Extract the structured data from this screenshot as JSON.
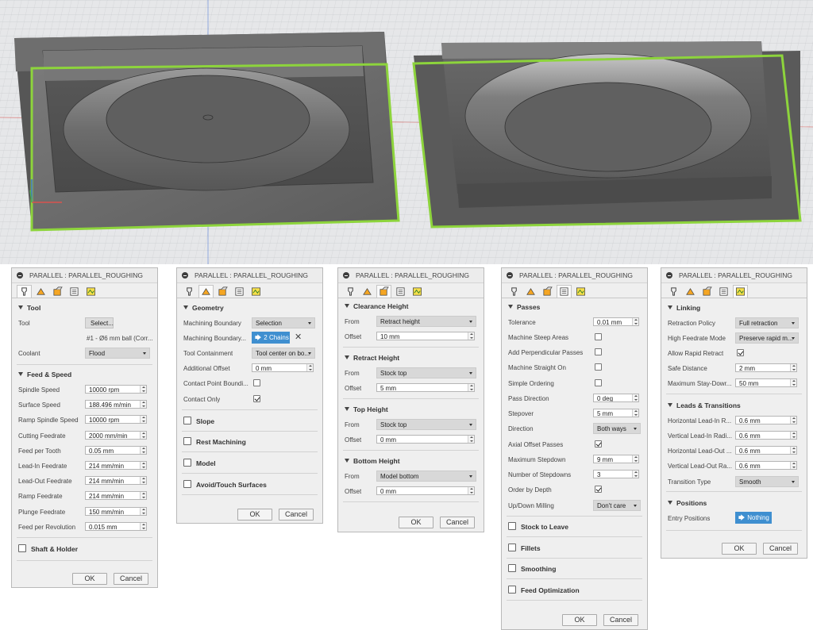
{
  "colors": {
    "selection_outline": "#8dd43c",
    "chip": "#3f8fd0",
    "axis_x": "#d9534f",
    "axis_y": "#3b6bd6",
    "axis_z": "#4caf50"
  },
  "panels": [
    {
      "title": "PARALLEL : PARALLEL_ROUGHING",
      "tab_icons": [
        "tool-tab-icon",
        "geometry-tab-icon",
        "heights-tab-icon",
        "passes-tab-icon",
        "linking-tab-icon"
      ],
      "sections": [
        {
          "name": "Tool",
          "expanded": true
        },
        {
          "name": "Feed & Speed",
          "expanded": true
        },
        {
          "name": "Shaft & Holder",
          "expanded": false
        }
      ],
      "tool": {
        "label": "Tool",
        "button": "Select...",
        "description": "#1 - Ø6 mm ball (Corr..."
      },
      "coolant": {
        "label": "Coolant",
        "value": "Flood"
      },
      "feed_speed": [
        {
          "label": "Spindle Speed",
          "value": "10000 rpm"
        },
        {
          "label": "Surface Speed",
          "value": "188.496 m/min"
        },
        {
          "label": "Ramp Spindle Speed",
          "value": "10000 rpm"
        },
        {
          "label": "Cutting Feedrate",
          "value": "2000 mm/min"
        },
        {
          "label": "Feed per Tooth",
          "value": "0.05 mm"
        },
        {
          "label": "Lead-In Feedrate",
          "value": "214 mm/min"
        },
        {
          "label": "Lead-Out Feedrate",
          "value": "214 mm/min"
        },
        {
          "label": "Ramp Feedrate",
          "value": "214 mm/min"
        },
        {
          "label": "Plunge Feedrate",
          "value": "150 mm/min"
        },
        {
          "label": "Feed per Revolution",
          "value": "0.015 mm"
        }
      ],
      "ok": "OK",
      "cancel": "Cancel"
    },
    {
      "title": "PARALLEL : PARALLEL_ROUGHING",
      "sections": [
        {
          "name": "Geometry",
          "expanded": true
        },
        {
          "name": "Slope",
          "expanded": false
        },
        {
          "name": "Rest Machining",
          "expanded": false
        },
        {
          "name": "Model",
          "expanded": false
        },
        {
          "name": "Avoid/Touch Surfaces",
          "expanded": false
        }
      ],
      "machining_boundary": {
        "label": "Machining Boundary",
        "value": "Selection"
      },
      "machining_boundary_sel": {
        "label": "Machining Boundary...",
        "value": "2 Chains"
      },
      "tool_containment": {
        "label": "Tool Containment",
        "value": "Tool center on bo..."
      },
      "additional_offset": {
        "label": "Additional Offset",
        "value": "0 mm"
      },
      "contact_point": {
        "label": "Contact Point Boundi...",
        "checked": false
      },
      "contact_only": {
        "label": "Contact Only",
        "checked": true
      },
      "ok": "OK",
      "cancel": "Cancel"
    },
    {
      "title": "PARALLEL : PARALLEL_ROUGHING",
      "sections": [
        {
          "name": "Clearance Height",
          "from": "Retract height",
          "offset": "10 mm"
        },
        {
          "name": "Retract Height",
          "from": "Stock top",
          "offset": "5 mm"
        },
        {
          "name": "Top Height",
          "from": "Stock top",
          "offset": "0 mm"
        },
        {
          "name": "Bottom Height",
          "from": "Model bottom",
          "offset": "0 mm"
        }
      ],
      "from_label": "From",
      "offset_label": "Offset",
      "ok": "OK",
      "cancel": "Cancel"
    },
    {
      "title": "PARALLEL : PARALLEL_ROUGHING",
      "sections": [
        {
          "name": "Passes",
          "expanded": true
        },
        {
          "name": "Stock to Leave",
          "expanded": false
        },
        {
          "name": "Fillets",
          "expanded": false
        },
        {
          "name": "Smoothing",
          "expanded": false
        },
        {
          "name": "Feed Optimization",
          "expanded": false
        }
      ],
      "tolerance": {
        "label": "Tolerance",
        "value": "0.01 mm"
      },
      "machine_steep": {
        "label": "Machine Steep Areas",
        "checked": false
      },
      "add_perpendicular": {
        "label": "Add Perpendicular Passes",
        "checked": false
      },
      "machine_straight": {
        "label": "Machine Straight On",
        "checked": false
      },
      "simple_ordering": {
        "label": "Simple Ordering",
        "checked": false
      },
      "pass_direction": {
        "label": "Pass Direction",
        "value": "0 deg"
      },
      "stepover": {
        "label": "Stepover",
        "value": "5 mm"
      },
      "direction": {
        "label": "Direction",
        "value": "Both ways"
      },
      "axial_offset": {
        "label": "Axial Offset Passes",
        "checked": true
      },
      "max_stepdown": {
        "label": "Maximum Stepdown",
        "value": "9 mm"
      },
      "num_stepdowns": {
        "label": "Number of Stepdowns",
        "value": "3"
      },
      "order_by_depth": {
        "label": "Order by Depth",
        "checked": true
      },
      "updown": {
        "label": "Up/Down Milling",
        "value": "Don't care"
      },
      "ok": "OK",
      "cancel": "Cancel"
    },
    {
      "title": "PARALLEL : PARALLEL_ROUGHING",
      "sections": [
        {
          "name": "Linking",
          "expanded": true
        },
        {
          "name": "Leads & Transitions",
          "expanded": true
        },
        {
          "name": "Positions",
          "expanded": true
        }
      ],
      "retraction_policy": {
        "label": "Retraction Policy",
        "value": "Full retraction"
      },
      "high_feedrate": {
        "label": "High Feedrate Mode",
        "value": "Preserve rapid m..."
      },
      "allow_rapid": {
        "label": "Allow Rapid Retract",
        "checked": true
      },
      "safe_distance": {
        "label": "Safe Distance",
        "value": "2 mm"
      },
      "max_stay_down": {
        "label": "Maximum Stay-Dowr...",
        "value": "50 mm"
      },
      "leads": [
        {
          "label": "Horizontal Lead-In R...",
          "value": "0.6 mm"
        },
        {
          "label": "Vertical Lead-In Radi...",
          "value": "0.6 mm"
        },
        {
          "label": "Horizontal Lead-Out ...",
          "value": "0.6 mm"
        },
        {
          "label": "Vertical Lead-Out Ra...",
          "value": "0.6 mm"
        }
      ],
      "transition_type": {
        "label": "Transition Type",
        "value": "Smooth"
      },
      "entry_positions": {
        "label": "Entry Positions",
        "value": "Nothing"
      },
      "ok": "OK",
      "cancel": "Cancel"
    }
  ]
}
